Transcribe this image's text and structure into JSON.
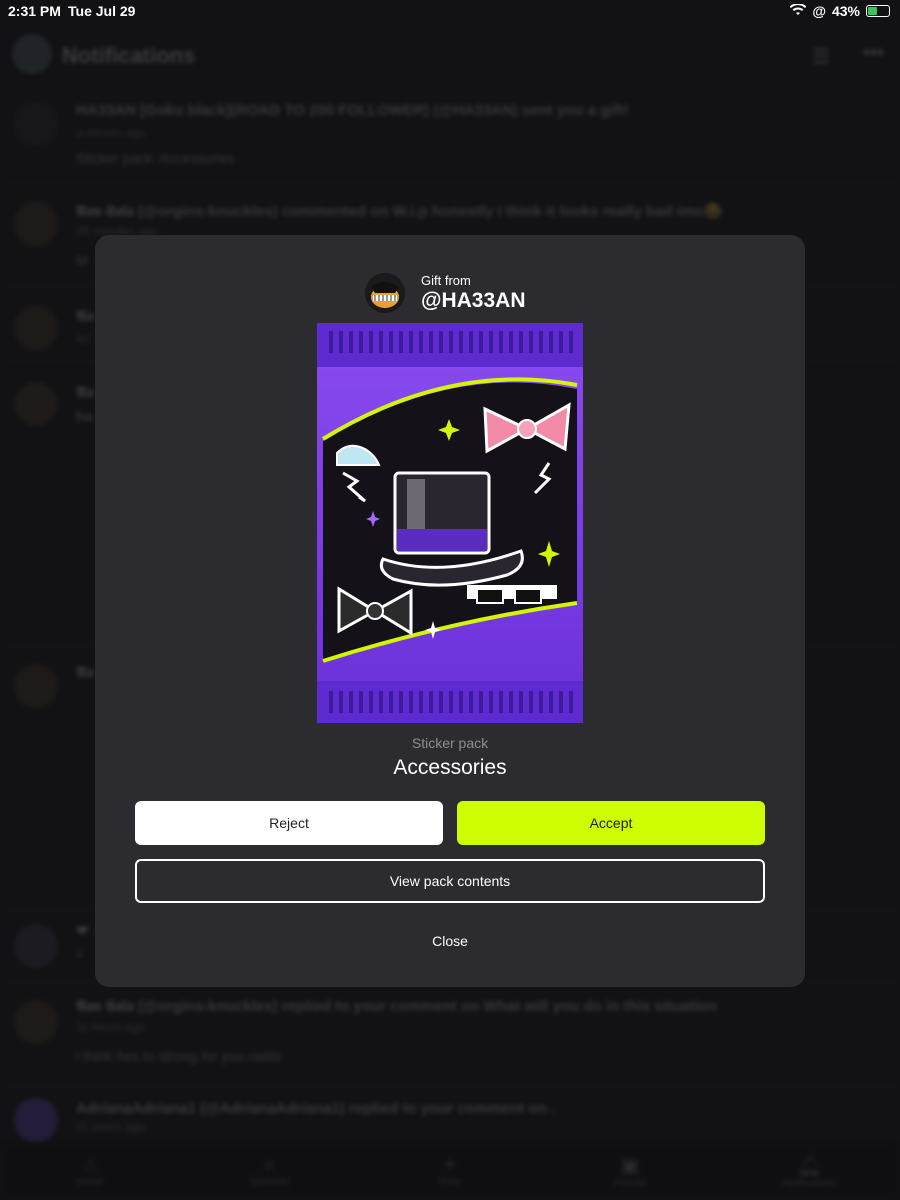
{
  "status_bar": {
    "time": "2:31 PM",
    "date": "Tue Jul 29",
    "battery": "43%"
  },
  "header": {
    "title": "Notifications"
  },
  "notifications": [
    {
      "line1": "HA33AN [Goku black](ROAD TO 200 FOLLOWER) (@HA33AN) sent you a gift!",
      "line2": "a minute ago",
      "line3": "Sticker pack: Accessories"
    },
    {
      "line1": "𝕬𝖔𝖓 𝕾𝖔𝖑𝖆 (@orgins-knuckles) commented on W.i.p honestly I think it looks really bad imo😂",
      "line2": "28 minutes ago",
      "line3": "M"
    },
    {
      "line1": "𝕬𝖔",
      "line2": "42",
      "line3": ""
    },
    {
      "line1": "𝕬𝖔",
      "line2": "ha",
      "line3": ""
    },
    {
      "line1": "𝕬𝖔",
      "line2": "",
      "line3": ""
    },
    {
      "line1": "❤",
      "line2": "4",
      "line3": ""
    },
    {
      "line1": "𝕬𝖔𝖓 𝕾𝖔𝖑𝖆 (@orgins-knuckles) replied to your comment on What will you do in this situation",
      "line2": "11 hours ago",
      "line3": "i think hes to strong for you raditz"
    },
    {
      "line1": "AdrianaAdriana1 (@AdrianaAdriana1) replied to your comment on .",
      "line2": "11 hours ago",
      "line3": ""
    }
  ],
  "tabs": [
    {
      "label": "Home",
      "icon": "home-icon"
    },
    {
      "label": "Discover",
      "icon": "search-icon"
    },
    {
      "label": "Post",
      "icon": "plus-icon"
    },
    {
      "label": "Friends",
      "icon": "chat-icon"
    },
    {
      "label": "Notifications",
      "icon": "bell-icon"
    }
  ],
  "modal": {
    "gift_label": "Gift from",
    "gift_user": "@HA33AN",
    "pack_type": "Sticker pack",
    "pack_name": "Accessories",
    "reject_label": "Reject",
    "accept_label": "Accept",
    "view_label": "View pack contents",
    "close_label": "Close"
  },
  "colors": {
    "accent": "#cdfd00",
    "modal_bg": "#2c2b30",
    "pack_purple": "#7b3fe4"
  }
}
